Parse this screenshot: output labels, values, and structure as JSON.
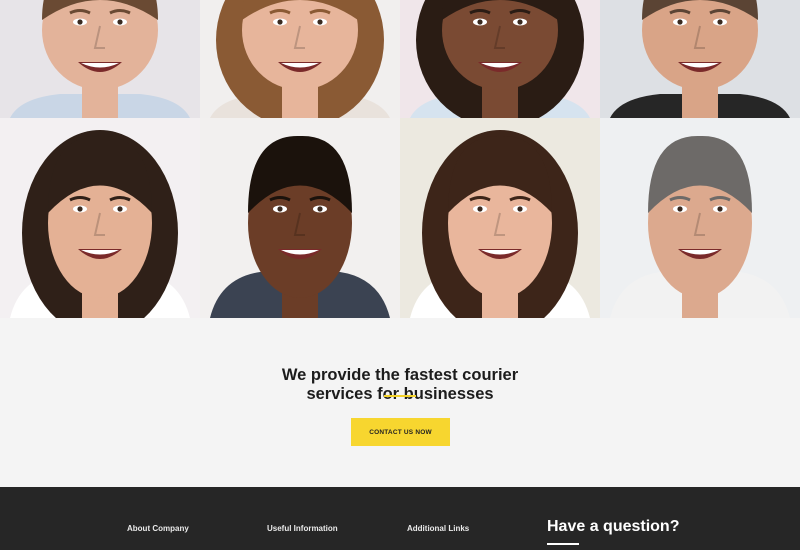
{
  "gallery": {
    "tiles": [
      {
        "name": "portrait-man-blue-shirt",
        "bg": "#e7e4e8",
        "skin": "#e3b39a",
        "hair": "#6a4a33",
        "shirt": "#c9d6e6"
      },
      {
        "name": "portrait-woman-long-brown-hair",
        "bg": "#f1efee",
        "skin": "#e7b59b",
        "hair": "#8a5a34",
        "shirt": "#e9e2dc"
      },
      {
        "name": "portrait-woman-curly-hair",
        "bg": "#f0e6ea",
        "skin": "#7a4a33",
        "hair": "#2a1c14",
        "shirt": "#d6e3ef"
      },
      {
        "name": "portrait-man-stubble",
        "bg": "#dde0e4",
        "skin": "#d9a487",
        "hair": "#5b4434",
        "shirt": "#262626"
      },
      {
        "name": "portrait-woman-dark-hair",
        "bg": "#f3f0f2",
        "skin": "#e4b195",
        "hair": "#2f2018",
        "shirt": "#ffffff"
      },
      {
        "name": "portrait-man-smiling",
        "bg": "#f2f0ef",
        "skin": "#6b3d27",
        "hair": "#1b120c",
        "shirt": "#3b4352"
      },
      {
        "name": "portrait-woman-white-blouse",
        "bg": "#ece9e0",
        "skin": "#e9b69c",
        "hair": "#3d2519",
        "shirt": "#ffffff"
      },
      {
        "name": "portrait-man-grey-hair",
        "bg": "#eef0f2",
        "skin": "#dca98e",
        "hair": "#6d6a68",
        "shirt": "#f2f2f2"
      }
    ]
  },
  "cta": {
    "headline_line1": "We provide the fastest courier",
    "headline_line2": "services for businesses",
    "button_label": "CONTACT US NOW",
    "accent": "#f7d62f"
  },
  "footer": {
    "col1": "About Company",
    "col2": "Useful Information",
    "col3": "Additional Links",
    "question": "Have a question?",
    "bg": "#262626"
  }
}
